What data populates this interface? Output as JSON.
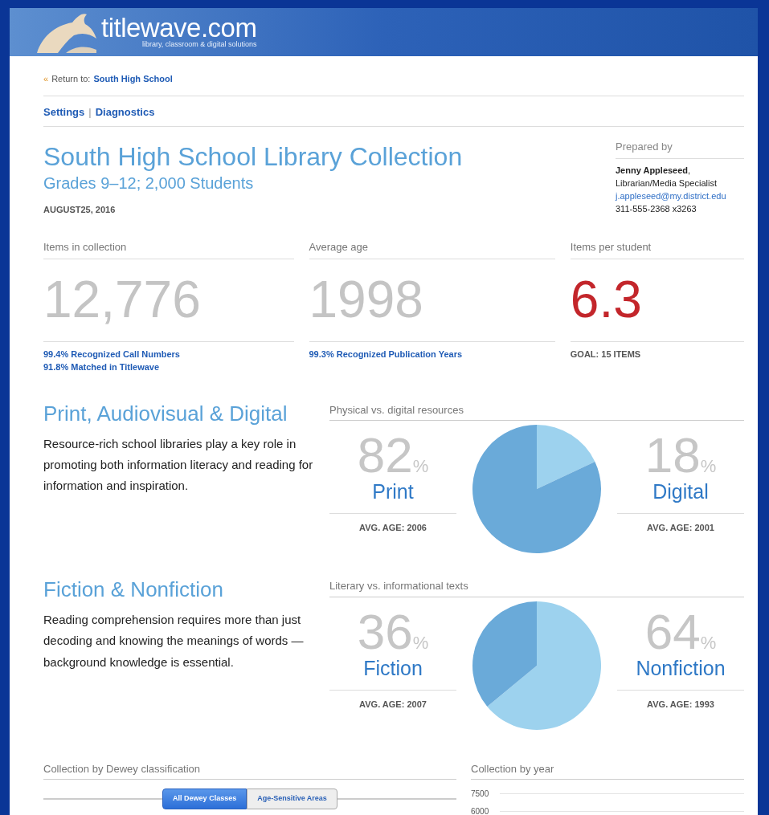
{
  "banner": {
    "logo_text": "titlewave.com",
    "tagline": "library, classroom & digital solutions"
  },
  "breadcrumb": {
    "icon_text": "«",
    "label": "Return to:",
    "link": "South High School"
  },
  "nav": {
    "links": [
      "Settings",
      "Diagnostics"
    ],
    "separator": "|"
  },
  "report": {
    "title": "South High School Library Collection",
    "subtitle": "Grades 9–12; 2,000 Students",
    "date": "AUGUST25, 2016"
  },
  "prepared_by": {
    "heading": "Prepared by",
    "name": "**Jenny Appleseed**,",
    "role": "Librarian/Media Specialist",
    "email": "j.appleseed@my.district.edu",
    "phone": "311-555-2368 x3263"
  },
  "stats": [
    {
      "label": "Items in collection",
      "value": "12,776",
      "highlight": false,
      "notes": [
        {
          "text": "99.4% Recognized Call Numbers",
          "kind": "link"
        },
        {
          "text": "91.8% Matched in Titlewave",
          "kind": "link"
        }
      ]
    },
    {
      "label": "Average age",
      "value": "1998",
      "highlight": false,
      "notes": [
        {
          "text": "99.3% Recognized Publication Years",
          "kind": "link"
        }
      ]
    },
    {
      "label": "Items per student",
      "value": "6.3",
      "highlight": true,
      "notes": [
        {
          "text": "GOAL: 15 ITEMS",
          "kind": "plain"
        }
      ]
    }
  ],
  "sections": [
    {
      "heading": "Print, Audiovisual & Digital",
      "body": "Resource-rich school libraries play a key role in promoting both information literacy and reading for information and inspiration.",
      "chart_title": "Physical vs. digital resources",
      "sides": [
        {
          "percent": "82",
          "unit": "%",
          "avg_age": "AVG. AGE: 2006",
          "color": "#6aaad9"
        },
        {
          "percent": "18",
          "unit": "%",
          "avg_age": "AVG. AGE: 2001",
          "color": "#9dd2ee"
        }
      ],
      "chart_data": {
        "type": "pie",
        "categories": [
          "Print",
          "Digital"
        ],
        "values": [
          82,
          18
        ]
      }
    },
    {
      "heading": "Fiction & Nonfiction",
      "body": "Reading comprehension requires more than just decoding and knowing the meanings of words — background knowledge is essential.",
      "chart_title": "Literary vs. informational texts",
      "sides": [
        {
          "percent": "36",
          "unit": "%",
          "avg_age": "AVG. AGE: 2007",
          "color": "#6aaad9"
        },
        {
          "percent": "64",
          "unit": "%",
          "avg_age": "AVG. AGE: 1993",
          "color": "#9dd2ee"
        }
      ],
      "chart_data": {
        "type": "pie",
        "categories": [
          "Fiction",
          "Nonfiction"
        ],
        "values": [
          36,
          64
        ]
      }
    }
  ],
  "dewey": {
    "heading": "Collection by Dewey classification",
    "toggles": [
      {
        "label": "All Dewey Classes",
        "selected": true
      },
      {
        "label": "Age-Sensitive Areas",
        "selected": false
      }
    ]
  },
  "year_chart": {
    "heading": "Collection by year",
    "axis_labels": [
      "7500",
      "6000"
    ]
  }
}
